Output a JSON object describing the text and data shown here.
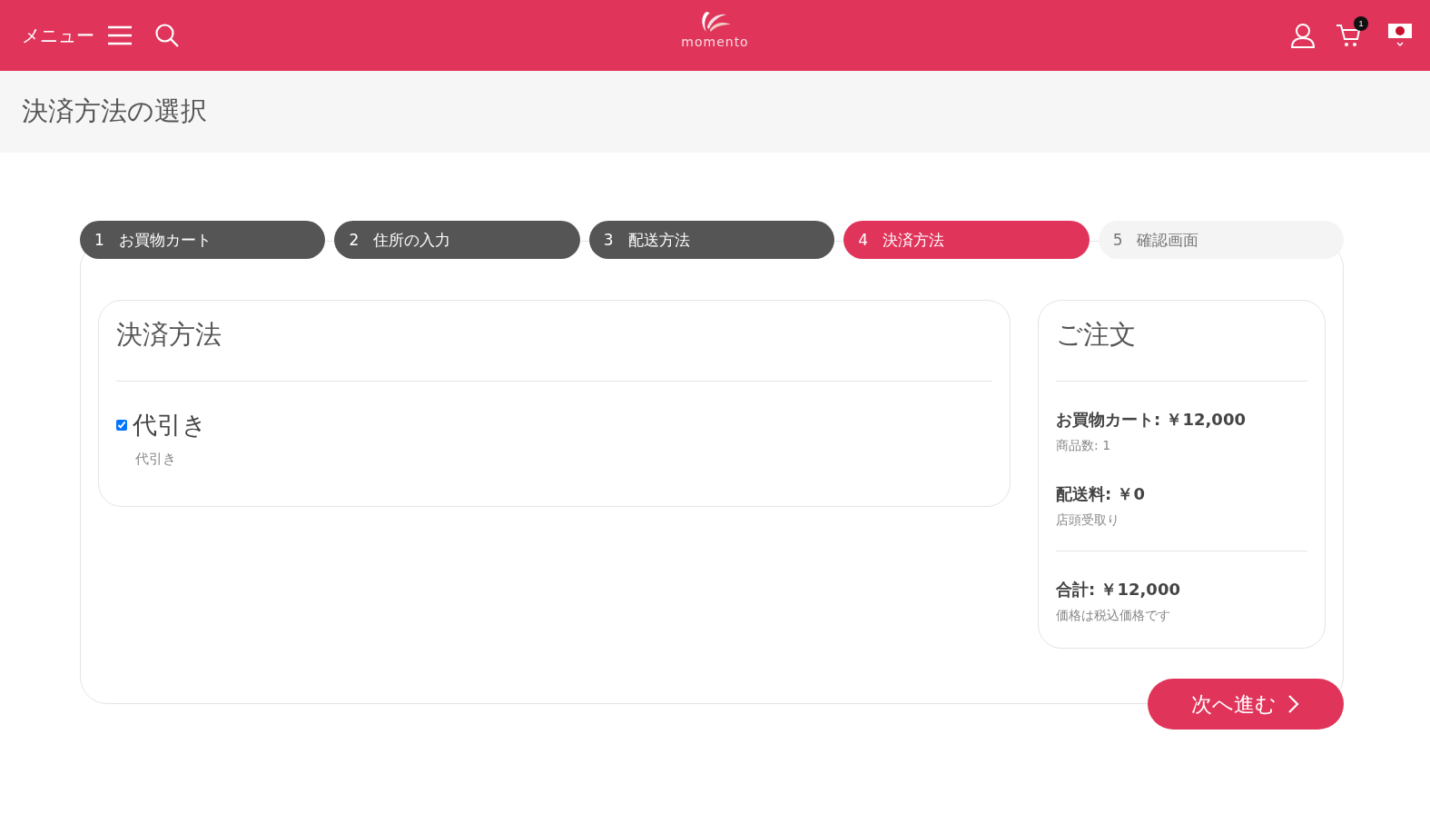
{
  "header": {
    "menu_label": "メニュー",
    "logo_text": "momento",
    "cart_count": "1"
  },
  "page_title": "決済方法の選択",
  "steps": [
    {
      "number": "1",
      "label": "お買物カート",
      "completed": true,
      "selected": false
    },
    {
      "number": "2",
      "label": "住所の入力",
      "completed": true,
      "selected": false
    },
    {
      "number": "3",
      "label": "配送方法",
      "completed": true,
      "selected": false
    },
    {
      "number": "4",
      "label": "決済方法",
      "completed": false,
      "selected": true
    },
    {
      "number": "5",
      "label": "確認画面",
      "completed": false,
      "selected": false
    }
  ],
  "payment": {
    "title": "決済方法",
    "options": [
      {
        "label": "代引き",
        "description": "代引き",
        "checked": true
      }
    ]
  },
  "order": {
    "title": "ご注文",
    "groups": [
      {
        "heading": "お買物カート: ￥12,000",
        "note": "商品数: 1"
      },
      {
        "heading": "配送料: ￥0",
        "note": "店頭受取り"
      }
    ],
    "total": {
      "heading": "合計: ￥12,000",
      "note": "価格は税込価格です"
    }
  },
  "next_button": "次へ進む"
}
